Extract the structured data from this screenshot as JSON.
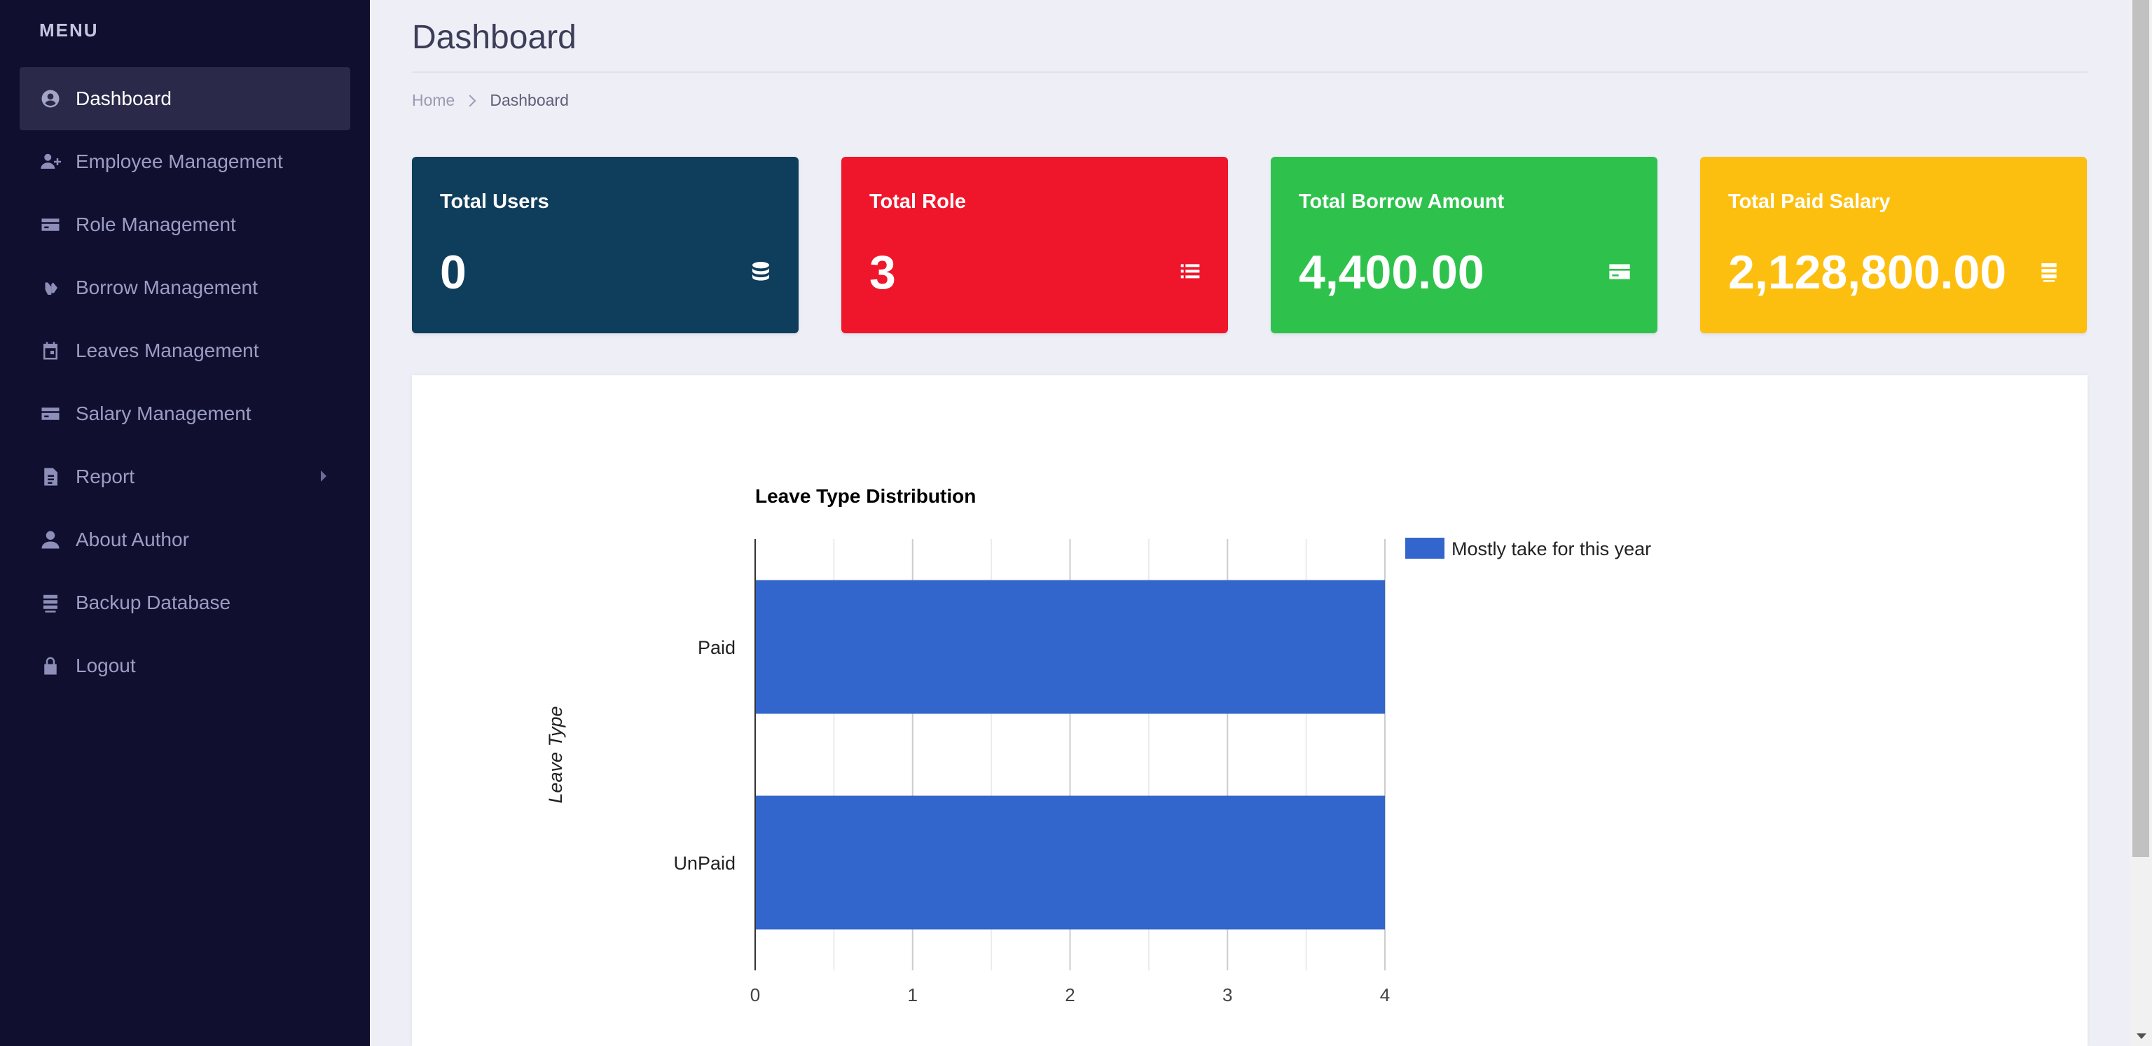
{
  "sidebar": {
    "menu_title": "MENU",
    "items": [
      {
        "label": "Dashboard",
        "icon": "user-circle-icon",
        "active": true
      },
      {
        "label": "Employee Management",
        "icon": "user-plus-icon"
      },
      {
        "label": "Role Management",
        "icon": "credit-card-icon"
      },
      {
        "label": "Borrow Management",
        "icon": "hand-holding-icon"
      },
      {
        "label": "Leaves Management",
        "icon": "calendar-icon"
      },
      {
        "label": "Salary Management",
        "icon": "credit-card-icon"
      },
      {
        "label": "Report",
        "icon": "file-icon",
        "has_submenu": true
      },
      {
        "label": "About Author",
        "icon": "user-icon"
      },
      {
        "label": "Backup Database",
        "icon": "database-icon"
      },
      {
        "label": "Logout",
        "icon": "lock-icon"
      }
    ]
  },
  "header": {
    "title": "Dashboard",
    "breadcrumb": {
      "home": "Home",
      "current": "Dashboard"
    }
  },
  "cards": [
    {
      "title": "Total Users",
      "value": "0",
      "icon": "database-icon",
      "color": "#0f3d5c"
    },
    {
      "title": "Total Role",
      "value": "3",
      "icon": "list-icon",
      "color": "#ef162c"
    },
    {
      "title": "Total Borrow Amount",
      "value": "4,400.00",
      "icon": "credit-card-icon",
      "color": "#2ec24d"
    },
    {
      "title": "Total Paid Salary",
      "value": "2,128,800.00",
      "icon": "database-icon",
      "color": "#fdbf0f"
    }
  ],
  "chart_data": {
    "type": "bar",
    "orientation": "horizontal",
    "title": "Leave Type Distribution",
    "ylabel": "Leave Type",
    "xlabel": "",
    "categories": [
      "Paid",
      "UnPaid"
    ],
    "series": [
      {
        "name": "Mostly take for this year",
        "values": [
          4,
          4
        ],
        "color": "#3366cc"
      }
    ],
    "xlim": [
      0,
      4
    ],
    "xticks": [
      "0",
      "1",
      "2",
      "3",
      "4"
    ],
    "grid": true,
    "legend": "right"
  }
}
